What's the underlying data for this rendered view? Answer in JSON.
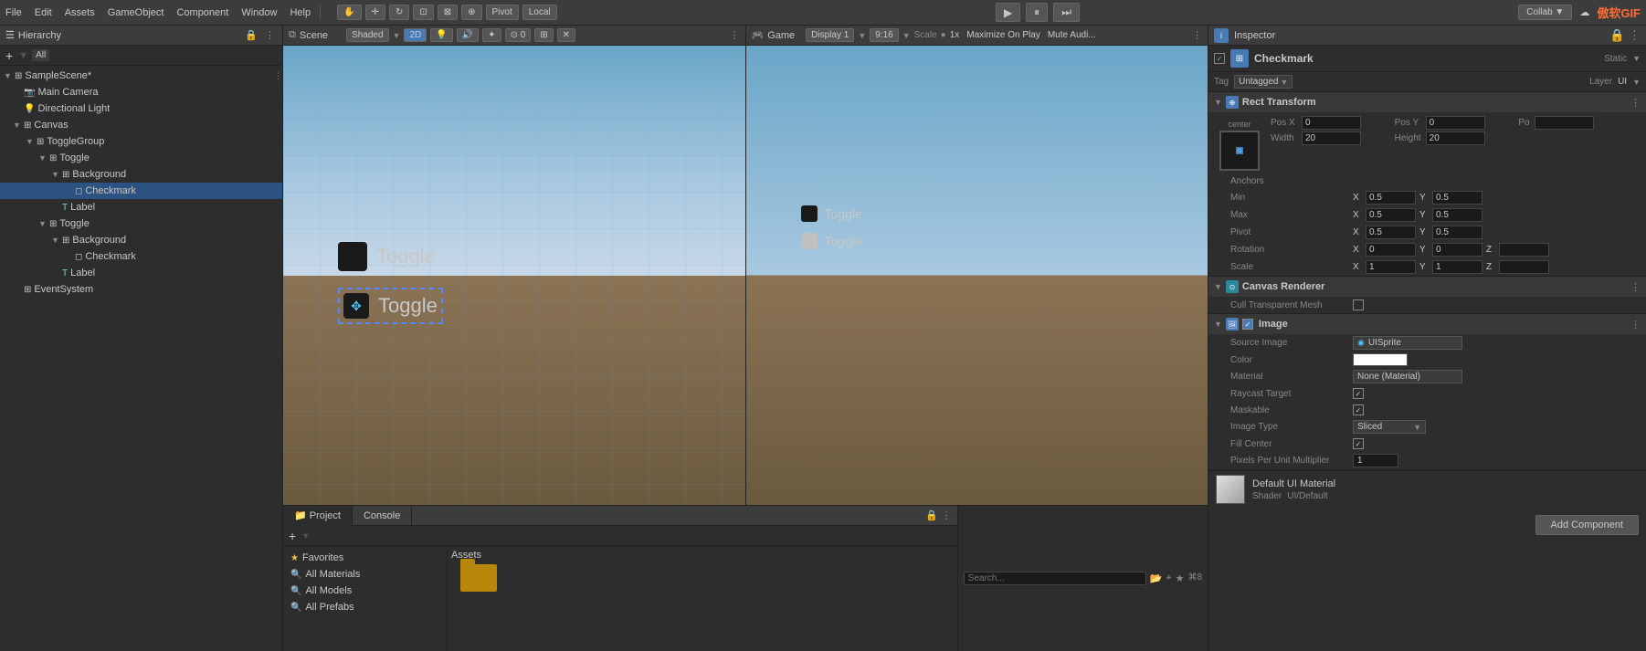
{
  "topbar": {
    "menus": [
      "File",
      "Edit",
      "Assets",
      "GameObject",
      "Component",
      "Window",
      "Help"
    ],
    "pivot_label": "Pivot",
    "local_label": "Local",
    "play_btn": "▶",
    "pause_btn": "⏸",
    "step_btn": "⏭",
    "collab_label": "Collab ▼",
    "cloud_icon": "☁",
    "brand": "傲软GIF"
  },
  "hierarchy": {
    "title": "Hierarchy",
    "add_btn": "+",
    "filter_label": "All",
    "items": [
      {
        "label": "SampleScene*",
        "level": 0,
        "arrow": "▼",
        "icon": "⊞",
        "type": "scene"
      },
      {
        "label": "Main Camera",
        "level": 1,
        "arrow": "",
        "icon": "🎥",
        "type": "object"
      },
      {
        "label": "Directional Light",
        "level": 1,
        "arrow": "",
        "icon": "💡",
        "type": "object"
      },
      {
        "label": "Canvas",
        "level": 1,
        "arrow": "▼",
        "icon": "⊞",
        "type": "object"
      },
      {
        "label": "ToggleGroup",
        "level": 2,
        "arrow": "▼",
        "icon": "⊞",
        "type": "object"
      },
      {
        "label": "Toggle",
        "level": 3,
        "arrow": "▼",
        "icon": "⊞",
        "type": "object"
      },
      {
        "label": "Background",
        "level": 4,
        "arrow": "▼",
        "icon": "⊞",
        "type": "object"
      },
      {
        "label": "Checkmark",
        "level": 5,
        "arrow": "",
        "icon": "◻",
        "type": "object",
        "selected": true
      },
      {
        "label": "Label",
        "level": 4,
        "arrow": "",
        "icon": "T",
        "type": "text"
      },
      {
        "label": "Toggle",
        "level": 3,
        "arrow": "▼",
        "icon": "⊞",
        "type": "object"
      },
      {
        "label": "Background",
        "level": 4,
        "arrow": "▼",
        "icon": "⊞",
        "type": "object"
      },
      {
        "label": "Checkmark",
        "level": 5,
        "arrow": "",
        "icon": "◻",
        "type": "object"
      },
      {
        "label": "Label",
        "level": 4,
        "arrow": "",
        "icon": "T",
        "type": "text"
      },
      {
        "label": "EventSystem",
        "level": 1,
        "arrow": "",
        "icon": "⊞",
        "type": "object"
      }
    ]
  },
  "scene": {
    "title": "Scene",
    "shaded_label": "Shaded",
    "mode_2d": "2D",
    "toggle1_label": "Toggle",
    "toggle2_label": "Toggle"
  },
  "game": {
    "title": "Game",
    "display_label": "Display 1",
    "aspect_label": "9:16",
    "scale_label": "Scale",
    "scale_value": "1x",
    "maximize_label": "Maximize On Play",
    "mute_label": "Mute Audi...",
    "toggle1_label": "Toggle",
    "toggle2_label": "Toggle"
  },
  "inspector": {
    "title": "Inspector",
    "object_name": "Checkmark",
    "tag_label": "Tag",
    "tag_value": "Untagged",
    "layer_label": "Layer",
    "layer_value": "UI",
    "rect_transform": {
      "title": "Rect Transform",
      "pos_x_label": "Pos X",
      "pos_y_label": "Pos Y",
      "pos_z_label": "Po",
      "pos_x_val": "0",
      "pos_y_val": "0",
      "width_label": "Width",
      "height_label": "Height",
      "width_val": "20",
      "height_val": "20",
      "anchor_label": "Anchors",
      "min_label": "Min",
      "max_label": "Max",
      "pivot_label": "Pivot",
      "min_x": "0.5",
      "min_y": "0.5",
      "max_x": "0.5",
      "max_y": "0.5",
      "pivot_x": "0.5",
      "pivot_y": "0.5",
      "rotation_label": "Rotation",
      "rot_x": "0",
      "rot_y": "0",
      "rot_z": "",
      "scale_label": "Scale",
      "scale_x": "1",
      "scale_y": "1",
      "scale_z": ""
    },
    "canvas_renderer": {
      "title": "Canvas Renderer",
      "cull_label": "Cull Transparent Mesh"
    },
    "image": {
      "title": "Image",
      "source_label": "Source Image",
      "source_value": "UISprite",
      "color_label": "Color",
      "material_label": "Material",
      "material_value": "None (Material)",
      "raycast_label": "Raycast Target",
      "maskable_label": "Maskable",
      "image_type_label": "Image Type",
      "image_type_value": "Sliced",
      "fill_center_label": "Fill Center",
      "pixels_label": "Pixels Per Unit Multiplier",
      "pixels_value": "1"
    },
    "default_material": {
      "name": "Default UI Material",
      "shader_label": "Shader",
      "shader_value": "UI/Default"
    },
    "add_component_label": "Add Component"
  },
  "bottom": {
    "project_tab": "Project",
    "console_tab": "Console",
    "favorites_label": "Favorites",
    "all_materials": "All Materials",
    "all_models": "All Models",
    "all_prefabs": "All Prefabs",
    "assets_label": "Assets"
  }
}
